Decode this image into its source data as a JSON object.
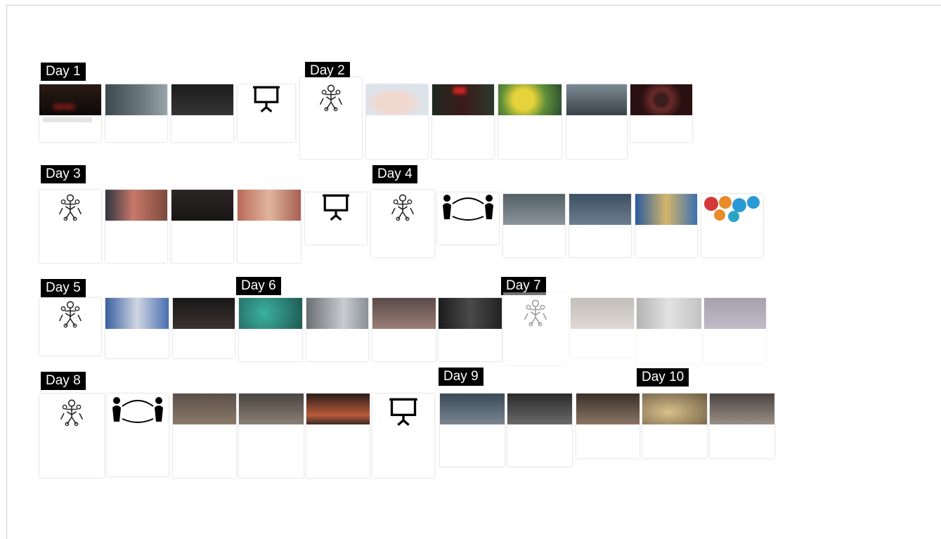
{
  "days": {
    "d1": "Day 1",
    "d2": "Day 2",
    "d3": "Day 3",
    "d4": "Day 4",
    "d5": "Day 5",
    "d6": "Day 6",
    "d7": "Day 7",
    "d8": "Day 8",
    "d9": "Day 9",
    "d10": "Day 10"
  },
  "colors": {
    "label_bg": "#000000",
    "label_text": "#ffffff",
    "accent_red": "#cc3333"
  },
  "icons": [
    "presentation-board-icon",
    "robot-figure-icon",
    "question-bubbles-icon"
  ]
}
